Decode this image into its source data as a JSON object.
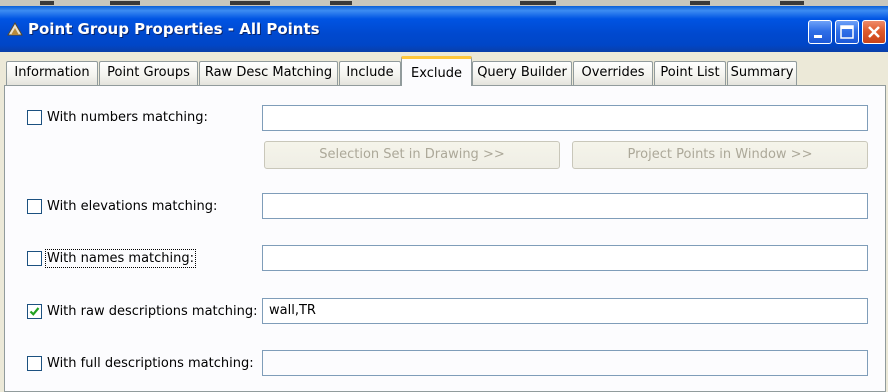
{
  "window": {
    "title": "Point Group Properties - All Points"
  },
  "tabs": [
    {
      "label": "Information",
      "active": false
    },
    {
      "label": "Point Groups",
      "active": false
    },
    {
      "label": "Raw Desc Matching",
      "active": false
    },
    {
      "label": "Include",
      "active": false
    },
    {
      "label": "Exclude",
      "active": true
    },
    {
      "label": "Query Builder",
      "active": false
    },
    {
      "label": "Overrides",
      "active": false
    },
    {
      "label": "Point List",
      "active": false
    },
    {
      "label": "Summary",
      "active": false
    }
  ],
  "exclude": {
    "numbers": {
      "label": "With numbers matching:",
      "checked": false,
      "value": ""
    },
    "selection_set_button": "Selection Set in Drawing >>",
    "project_points_button": "Project Points in Window >>",
    "elevations": {
      "label": "With elevations matching:",
      "checked": false,
      "value": ""
    },
    "names": {
      "label": "With names matching:",
      "checked": false,
      "value": ""
    },
    "raw_descriptions": {
      "label": "With raw descriptions matching:",
      "checked": true,
      "value": "wall,TR"
    },
    "full_descriptions": {
      "label": "With full descriptions matching:",
      "checked": false,
      "value": ""
    }
  },
  "colors": {
    "titlebar": "#0054e3",
    "active_tab_accent": "#ffc73c",
    "checkbox_check": "#21a121"
  }
}
